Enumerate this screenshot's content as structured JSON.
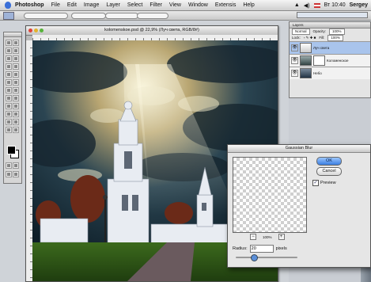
{
  "menubar": {
    "app": "Photoshop",
    "items": [
      "File",
      "Edit",
      "Image",
      "Layer",
      "Select",
      "Filter",
      "View",
      "Window",
      "Extensis",
      "Help"
    ],
    "clock": "Вт 10:40",
    "user": "Sergey"
  },
  "document": {
    "title": "kolomenskoe.psd @ 22,9% (Луч света, RGB/8#)"
  },
  "layers": {
    "title": "Layers",
    "mode": "Normal",
    "opacity_label": "Opacity:",
    "opacity": "100%",
    "fill_label": "Fill:",
    "fill": "100%",
    "lock_label": "Lock:",
    "rows": [
      {
        "name": "Луч света",
        "selected": true
      },
      {
        "name": "Коломенское",
        "selected": false
      },
      {
        "name": "Небо",
        "selected": false
      }
    ]
  },
  "dialog": {
    "title": "Gaussian Blur",
    "ok_label": "OK",
    "cancel_label": "Cancel",
    "preview_label": "Preview",
    "preview_checked": true,
    "zoom": "100%",
    "radius_label": "Radius:",
    "radius_value": "20",
    "radius_unit": "pixels",
    "radius_slider_fraction": 0.3
  },
  "colors": {
    "accent": "#3a7ee0",
    "selection": "#a9c4ec"
  }
}
